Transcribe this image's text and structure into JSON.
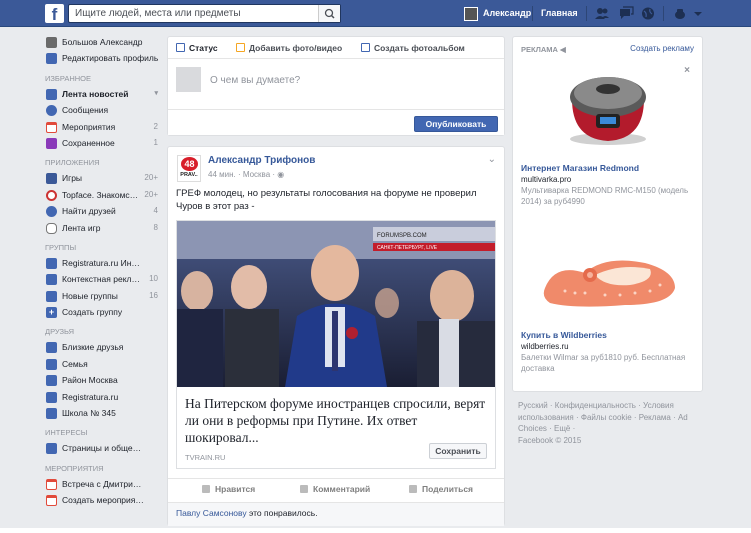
{
  "topbar": {
    "logo": "f",
    "search_placeholder": "Ищите людей, места или предметы",
    "user_name": "Александр",
    "home": "Главная"
  },
  "sidebar": {
    "profile": [
      {
        "label": "Большов Александр",
        "icon": "avatar"
      },
      {
        "label": "Редактировать профиль",
        "icon": "pencil-icon"
      }
    ],
    "favorites_header": "ИЗБРАННОЕ",
    "favorites": [
      {
        "label": "Лента новостей",
        "count": "",
        "icon": "newsfeed-icon",
        "color": "#4267b2"
      },
      {
        "label": "Сообщения",
        "count": "",
        "icon": "messages-icon",
        "color": "#4267b2"
      },
      {
        "label": "Мероприятия",
        "count": "2",
        "icon": "calendar-icon",
        "color": "#e14a3b"
      },
      {
        "label": "Сохраненное",
        "count": "1",
        "icon": "bookmark-icon",
        "color": "#8a3ab9"
      }
    ],
    "apps_header": "ПРИЛОЖЕНИЯ",
    "apps": [
      {
        "label": "Игры",
        "count": "20+",
        "icon": "games-icon",
        "color": "#3b5998"
      },
      {
        "label": "Topface. Знакомс…",
        "count": "20+",
        "icon": "topface-icon",
        "color": "#c33"
      },
      {
        "label": "Найти друзей",
        "count": "4",
        "icon": "friends-icon",
        "color": "#4267b2"
      },
      {
        "label": "Лента игр",
        "count": "8",
        "icon": "gamepad-icon",
        "color": "#777"
      }
    ],
    "groups_header": "ГРУППЫ",
    "groups": [
      {
        "label": "Registratura.ru Ин…",
        "count": "",
        "icon": "group-icon",
        "color": "#4267b2"
      },
      {
        "label": "Контекстная рекл…",
        "count": "10",
        "icon": "group-icon",
        "color": "#4267b2"
      },
      {
        "label": "Новые группы",
        "count": "16",
        "icon": "group-icon",
        "color": "#4267b2"
      },
      {
        "label": "Создать группу",
        "count": "",
        "icon": "plus-icon",
        "color": "#4267b2"
      }
    ],
    "friends_header": "ДРУЗЬЯ",
    "friends": [
      {
        "label": "Близкие друзья",
        "icon": "star-icon",
        "color": "#4267b2"
      },
      {
        "label": "Семья",
        "icon": "family-icon",
        "color": "#4267b2"
      },
      {
        "label": "Район Москва",
        "icon": "location-icon",
        "color": "#4267b2"
      },
      {
        "label": "Registratura.ru",
        "icon": "work-icon",
        "color": "#4267b2"
      },
      {
        "label": "Школа № 345",
        "icon": "school-icon",
        "color": "#4267b2"
      }
    ],
    "interests_header": "ИНТЕРЕСЫ",
    "interests": [
      {
        "label": "Страницы и обще…",
        "icon": "pages-icon",
        "color": "#4267b2"
      }
    ],
    "events_header": "МЕРОПРИЯТИЯ",
    "events": [
      {
        "label": "Встреча с Дмитри…",
        "icon": "calendar-icon",
        "color": "#e14a3b"
      },
      {
        "label": "Создать мероприя…",
        "icon": "calendar-plus-icon",
        "color": "#e14a3b"
      }
    ]
  },
  "composer": {
    "tab_status": "Статус",
    "tab_photo": "Добавить фото/видео",
    "tab_album": "Создать фотоальбом",
    "placeholder": "О чем вы думаете?",
    "publish": "Опубликовать"
  },
  "post": {
    "avatar_number": "48",
    "avatar_word": "PRAV..",
    "author": "Александр Трифонов",
    "time": "44 мин.",
    "place": "Москва",
    "text": "ГРЕФ молодец, но результаты голосования на форуме не проверил Чуров в этот раз -",
    "link_title": "На Питерском форуме иностранцев спросили, верят ли они в реформы при Путине. Их ответ шокировал...",
    "link_domain": "TVRAIN.RU",
    "image_caption_1": "FORUMSPB.COM",
    "image_caption_2": "САНКТ-ПЕТЕРБУРГ, LIVE",
    "save": "Сохранить",
    "like": "Нравится",
    "comment": "Комментарий",
    "share": "Поделиться",
    "liked_by": "Павлу Самсонову",
    "liked_suffix": " это понравилось."
  },
  "ads": {
    "header": "РЕКЛАМА",
    "create": "Создать рекламу",
    "close": "×",
    "items": [
      {
        "title": "Интернет Магазин Redmond",
        "url": "multivarka.pro",
        "desc": "Мультиварка REDMOND RMC-M150 (модель 2014) за руб4990"
      },
      {
        "title": "Купить в Wildberries",
        "url": "wildberries.ru",
        "desc": "Балетки Wilmar за руб1810 руб. Бесплатная доставка"
      }
    ]
  },
  "footer": {
    "line1": "Русский · Конфиденциальность · Условия использования · Файлы cookie · Реклама · Ad Choices",
    "more": " · Ещё ·",
    "copyright": "Facebook © 2015"
  }
}
